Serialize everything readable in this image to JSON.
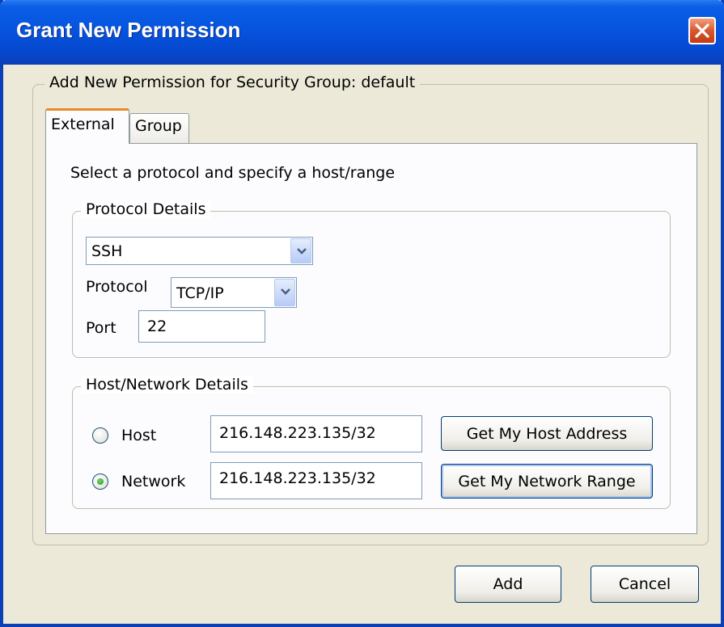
{
  "window": {
    "title": "Grant New Permission"
  },
  "outer_group": {
    "legend": "Add New Permission for Security Group: default"
  },
  "tabs": [
    {
      "label": "External",
      "selected": true
    },
    {
      "label": "Group",
      "selected": false
    }
  ],
  "external": {
    "instruction": "Select a protocol and specify a host/range",
    "protocol_details": {
      "legend": "Protocol Details",
      "service_select": {
        "value": "SSH"
      },
      "protocol_label": "Protocol",
      "protocol_select": {
        "value": "TCP/IP"
      },
      "port_label": "Port",
      "port_value": "22"
    },
    "host_network": {
      "legend": "Host/Network Details",
      "host": {
        "label": "Host",
        "value": "216.148.223.135/32",
        "selected": false,
        "button": "Get My Host Address"
      },
      "network": {
        "label": "Network",
        "value": "216.148.223.135/32",
        "selected": true,
        "button": "Get My Network Range"
      }
    }
  },
  "footer": {
    "add_label": "Add",
    "cancel_label": "Cancel"
  },
  "colors": {
    "titlebar": "#0654df",
    "dialog_bg": "#ece9d8",
    "tab_highlight": "#e68b2c",
    "radio_dot": "#21a121"
  },
  "icons": {
    "close": "close-icon",
    "dropdown": "chevron-down-icon"
  }
}
